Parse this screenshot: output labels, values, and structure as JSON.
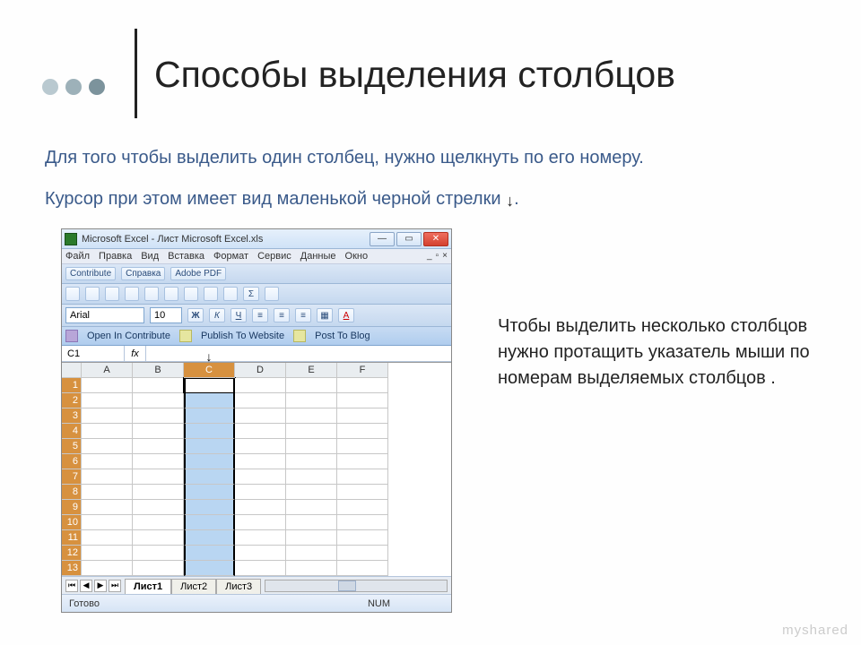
{
  "title": "Способы выделения столбцов",
  "para1_line1": "Для того чтобы выделить один столбец, нужно щелкнуть по его номеру.",
  "para1_line2_pre": "Курсор при этом имеет вид маленькой черной стрелки",
  "para1_line2_post": ".",
  "para_right": "Чтобы выделить несколько столбцов нужно протащить указатель мыши по номерам выделяемых столбцов .",
  "watermark": "myshared",
  "colors": {
    "dot1": "#b9c9d0",
    "dot2": "#9db1b9",
    "dot3": "#7c939c"
  },
  "excel": {
    "title": "Microsoft Excel - Лист Microsoft Excel.xls",
    "menu": [
      "Файл",
      "Правка",
      "Вид",
      "Вставка",
      "Формат",
      "Сервис",
      "Данные",
      "Окно"
    ],
    "doc_close": "×",
    "contribute_row": [
      "Contribute",
      "Справка",
      "Adobe PDF"
    ],
    "font_name": "Arial",
    "font_size": "10",
    "format_buttons": [
      "Ж",
      "К",
      "Ч"
    ],
    "open_row": {
      "open": "Open In Contribute",
      "publish": "Publish To Website",
      "post": "Post To Blog"
    },
    "name_box": "C1",
    "fx": "fx",
    "columns": [
      "A",
      "B",
      "C",
      "D",
      "E",
      "F"
    ],
    "selected_column_index": 2,
    "rows": [
      "1",
      "2",
      "3",
      "4",
      "5",
      "6",
      "7",
      "8",
      "9",
      "10",
      "11",
      "12",
      "13"
    ],
    "sheets": [
      "Лист1",
      "Лист2",
      "Лист3"
    ],
    "status_ready": "Готово",
    "status_num": "NUM"
  }
}
